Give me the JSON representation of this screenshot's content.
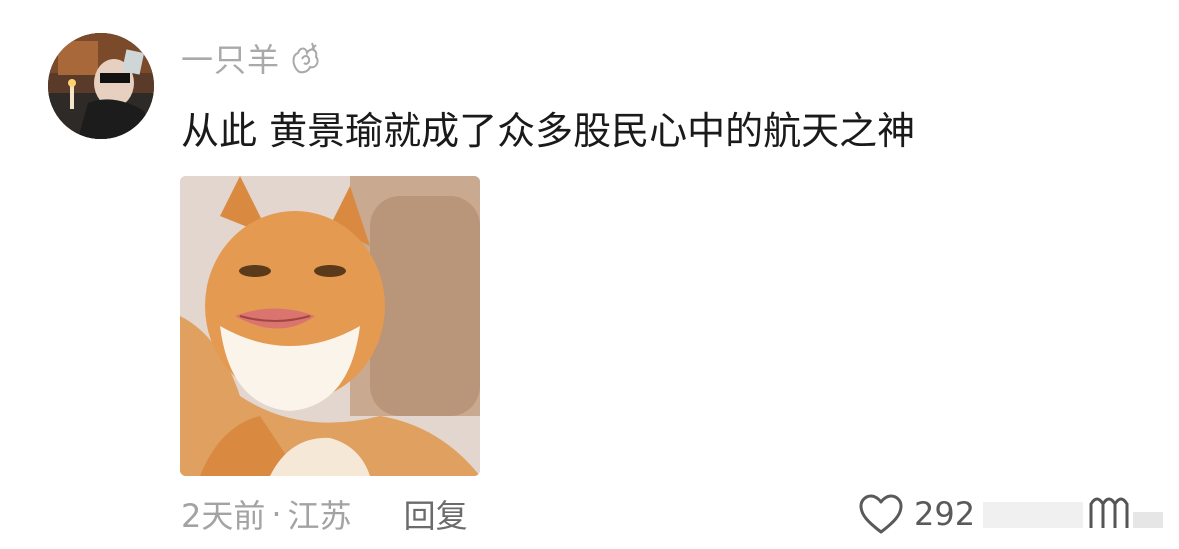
{
  "comment": {
    "author": {
      "name": "一只羊",
      "badge_icon": "flower-icon"
    },
    "text": "从此  黄景瑜就成了众多股民心中的航天之神",
    "media": {
      "description_icon": "cat-meme-image"
    },
    "meta": {
      "time": "2天前",
      "separator": "·",
      "location": "江苏"
    },
    "reply_label": "回复",
    "like": {
      "icon": "heart-icon",
      "count": "292"
    },
    "watermark": {
      "icon": "weibo-watermark"
    }
  },
  "colors": {
    "background": "#ffffff",
    "username": "#a9a9a9",
    "text": "#1a1a1a",
    "meta": "#a3a3a3",
    "reply": "#6b6b6b"
  }
}
